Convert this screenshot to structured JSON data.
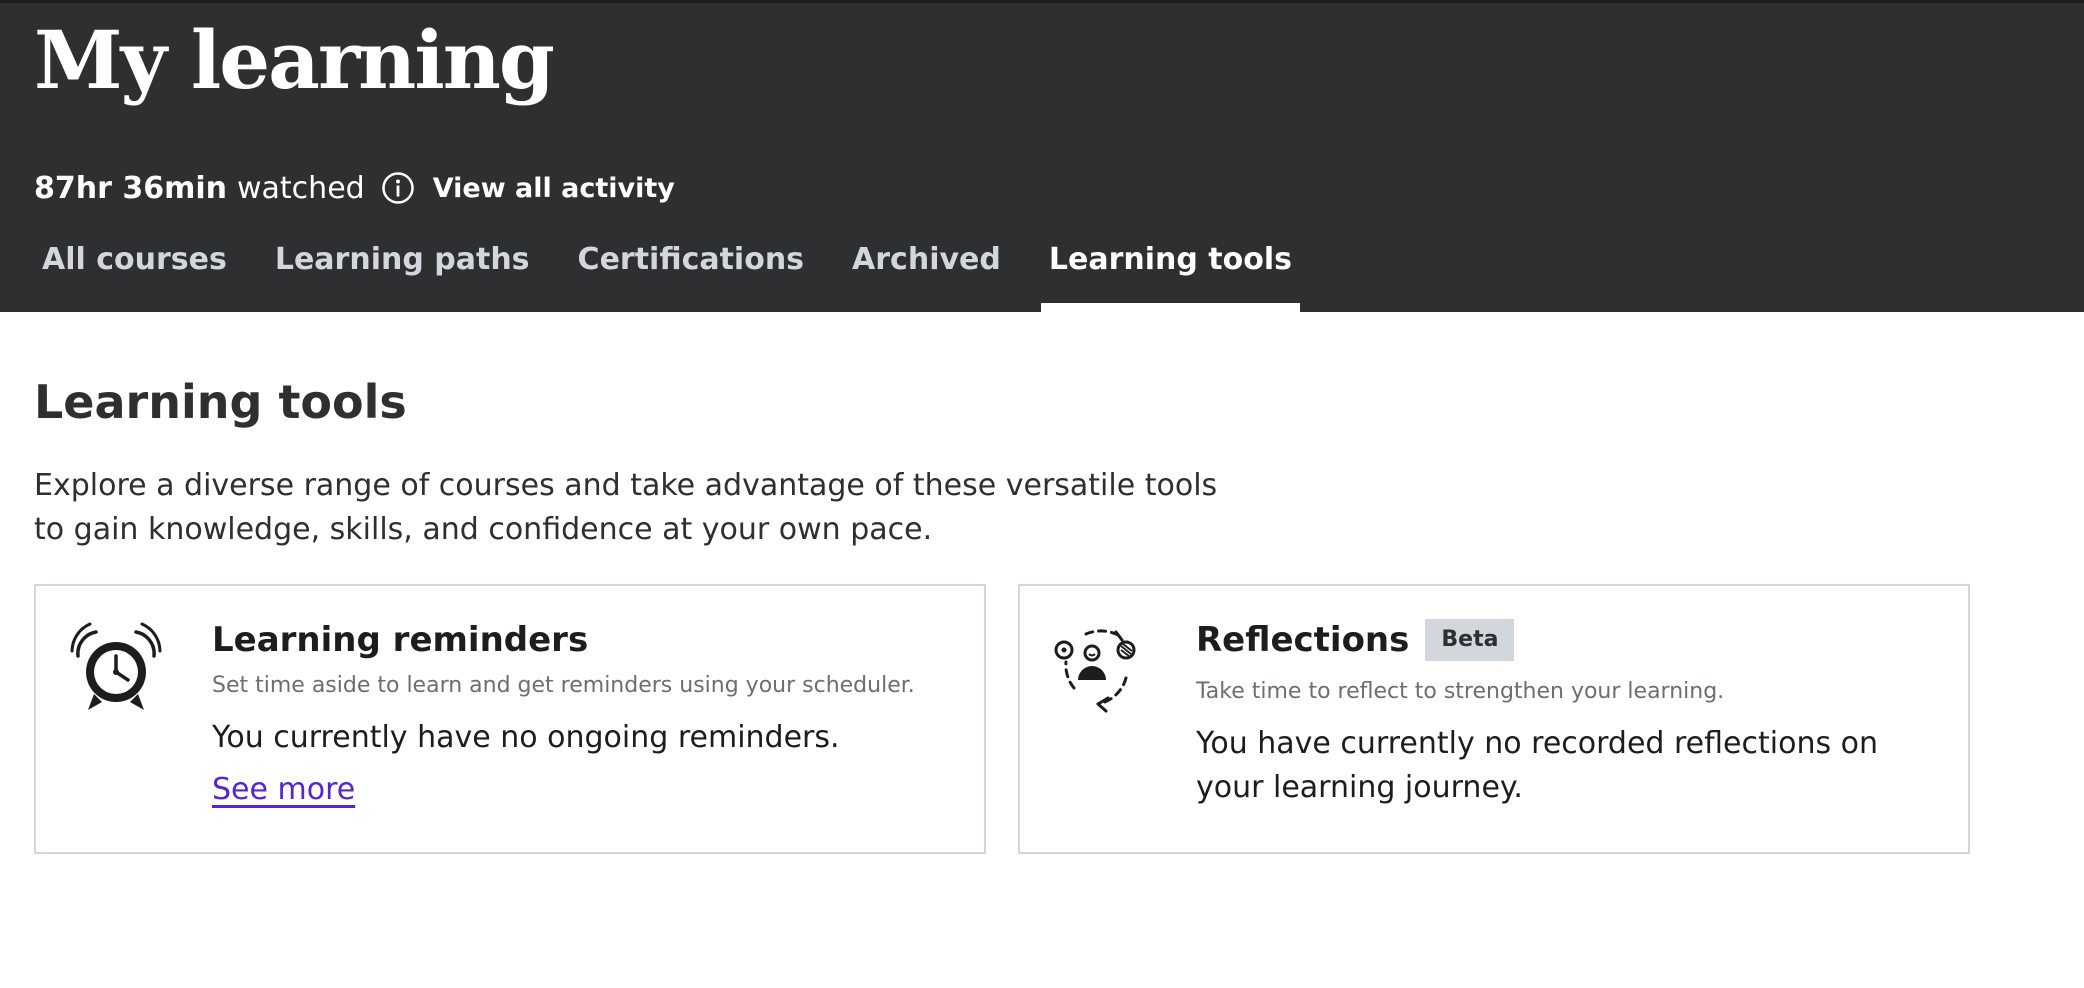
{
  "header": {
    "title": "My learning",
    "watched_time": "87hr 36min",
    "watched_label": "watched",
    "view_all_activity": "View all activity"
  },
  "tabs": [
    {
      "label": "All courses",
      "active": false
    },
    {
      "label": "Learning paths",
      "active": false
    },
    {
      "label": "Certifications",
      "active": false
    },
    {
      "label": "Archived",
      "active": false
    },
    {
      "label": "Learning tools",
      "active": true
    }
  ],
  "main": {
    "title": "Learning tools",
    "description": "Explore a diverse range of courses and take advantage of these versatile tools to gain knowledge, skills, and confidence at your own pace."
  },
  "cards": {
    "reminders": {
      "icon": "alarm-clock-icon",
      "title": "Learning reminders",
      "subtitle": "Set time aside to learn and get reminders using your scheduler.",
      "status": "You currently have no ongoing reminders.",
      "link": "See more"
    },
    "reflections": {
      "icon": "reflection-icon",
      "title": "Reflections",
      "badge": "Beta",
      "subtitle": "Take time to reflect to strengthen your learning.",
      "status": "You have currently no recorded reflections on your learning journey."
    }
  },
  "colors": {
    "header_bg": "#2d2f31",
    "link": "#5624d0",
    "badge_bg": "#d1d7dc",
    "card_border": "#d1d7dc"
  }
}
